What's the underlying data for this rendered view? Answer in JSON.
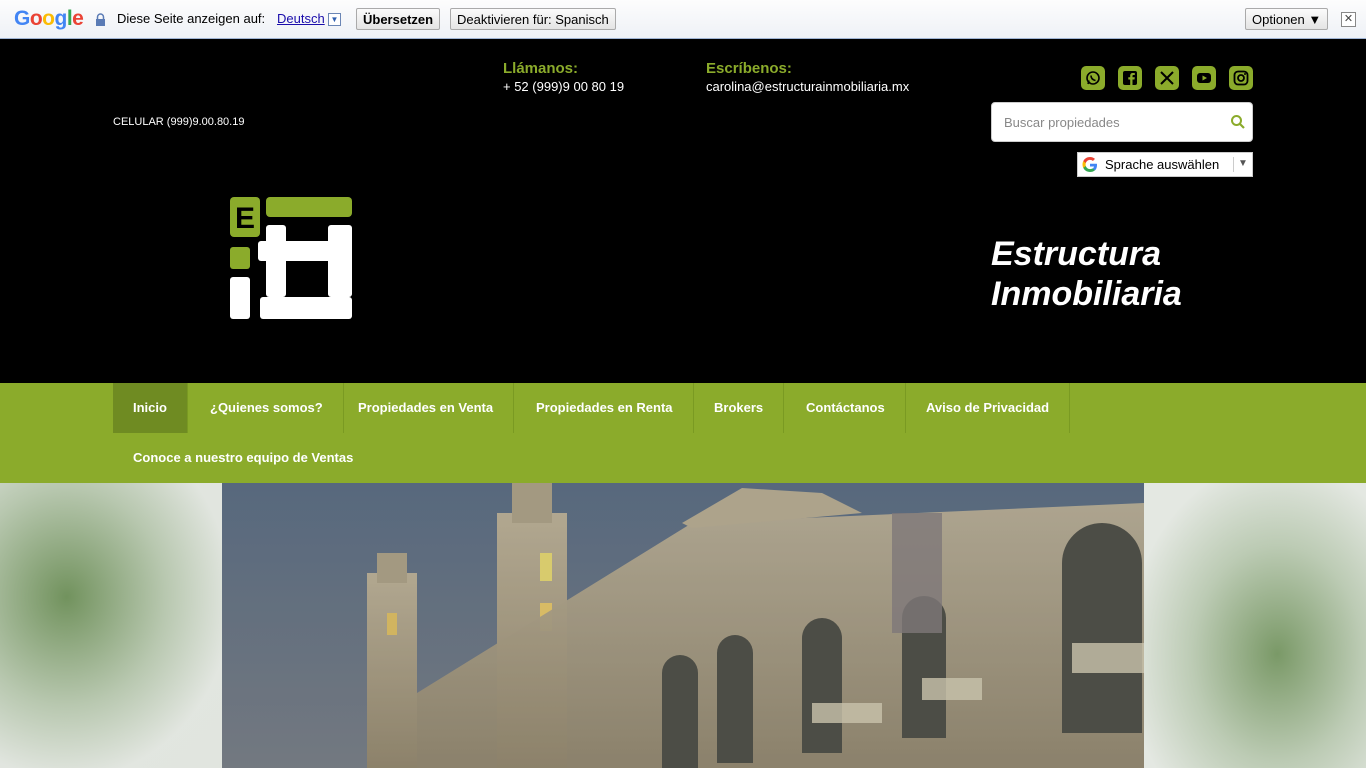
{
  "translate_bar": {
    "logo_text": "Google",
    "prompt": "Diese Seite anzeigen auf:",
    "language": "Deutsch",
    "translate_button": "Übersetzen",
    "deactivate_button": "Deaktivieren für: Spanisch",
    "options_button": "Optionen ▼",
    "close": "✕"
  },
  "header": {
    "call_label": "Llámanos:",
    "call_value": "+ 52 (999)9 00 80 19",
    "write_label": "Escríbenos:",
    "write_value": "carolina@estructurainmobiliaria.mx",
    "cellphone": "CELULAR (999)9.00.80.19",
    "search_placeholder": "Buscar propiedades",
    "language_select": "Sprache auswählen",
    "brand_line1": "Estructura",
    "brand_line2": "Inmobiliaria",
    "social_icons": [
      "whatsapp-icon",
      "facebook-icon",
      "x-icon",
      "youtube-icon",
      "instagram-icon"
    ]
  },
  "nav": {
    "items": [
      "Inicio",
      "¿Quienes somos?",
      "Propiedades en Venta",
      "Propiedades en Renta",
      "Brokers",
      "Contáctanos",
      "Aviso de Privacidad",
      "Conoce a nuestro equipo de Ventas"
    ],
    "active": "Inicio"
  },
  "colors": {
    "accent": "#8bab2b",
    "accent_dark": "#6f8b22",
    "header_bg": "#000000"
  }
}
